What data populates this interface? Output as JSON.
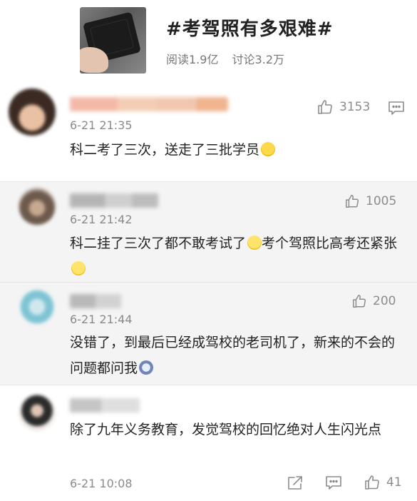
{
  "topic": {
    "title": "#考驾照有多艰难#",
    "reads": "阅读1.9亿",
    "discussions": "讨论3.2万"
  },
  "comments": [
    {
      "time": "6-21 21:35",
      "likes": "3153",
      "text_parts": [
        "科二考了三次，送走了三批学员"
      ],
      "emoji": [
        "laugh-cry"
      ]
    },
    {
      "time": "6-21 21:42",
      "likes": "1005",
      "text_parts": [
        "科二挂了三次了都不敢考试了",
        "考个驾照比高考还紧张"
      ],
      "emoji": [
        "smile",
        "smile"
      ]
    },
    {
      "time": "6-21 21:44",
      "likes": "200",
      "text_parts": [
        "没错了，到最后已经成驾校的老司机了，新来的不会的问题都问我"
      ],
      "emoji": [
        "shocked"
      ]
    },
    {
      "time": "6-21 10:08",
      "likes": "41",
      "text_parts": [
        "除了九年义务教育，发觉驾校的回忆绝对人生闪光点"
      ]
    }
  ],
  "icons": {
    "like": "thumbs-up-icon",
    "comment": "comment-icon",
    "forward": "forward-icon"
  },
  "colors": {
    "text": "#222222",
    "meta": "#8a8a8a",
    "alt_background": "#f4f4f4"
  }
}
